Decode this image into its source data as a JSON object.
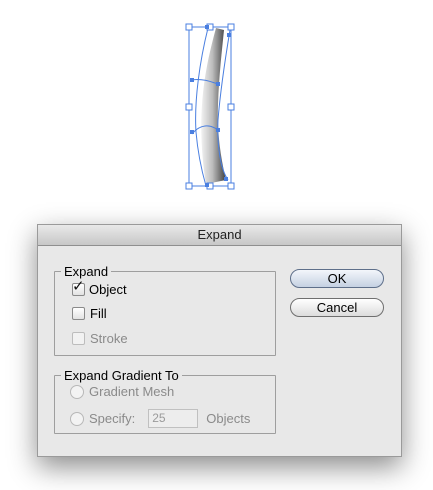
{
  "dialog": {
    "title": "Expand",
    "expand_group": {
      "legend": "Expand",
      "options": [
        {
          "label": "Object",
          "checked": true,
          "enabled": true
        },
        {
          "label": "Fill",
          "checked": false,
          "enabled": true
        },
        {
          "label": "Stroke",
          "checked": false,
          "enabled": false
        }
      ]
    },
    "gradient_group": {
      "legend": "Expand Gradient To",
      "gradient_mesh_label": "Gradient Mesh",
      "specify_label": "Specify:",
      "specify_value": "25",
      "objects_label": "Objects"
    },
    "buttons": {
      "ok": "OK",
      "cancel": "Cancel"
    }
  },
  "colors": {
    "selection": "#4a7fe0",
    "horn_light": "#e6e6e6",
    "horn_dark": "#4a4a4a"
  },
  "icons": {
    "checkmark": "✓"
  }
}
